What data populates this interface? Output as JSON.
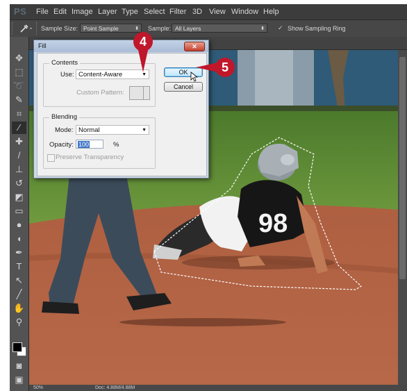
{
  "app": {
    "logo": "PS"
  },
  "menu": [
    "File",
    "Edit",
    "Image",
    "Layer",
    "Type",
    "Select",
    "Filter",
    "3D",
    "View",
    "Window",
    "Help"
  ],
  "options_bar": {
    "sample_size_label": "Sample Size:",
    "sample_size_value": "Point Sample",
    "sample_label": "Sample:",
    "sample_value": "All Layers",
    "show_ring_label": "Show Sampling Ring",
    "show_ring_checked": true
  },
  "status": {
    "zoom": "50%",
    "doc": "Doc: 4.88M/4.88M"
  },
  "fill_dialog": {
    "title": "Fill",
    "contents_group": "Contents",
    "use_label": "Use:",
    "use_value": "Content-Aware",
    "custom_pattern_label": "Custom Pattern:",
    "blending_group": "Blending",
    "mode_label": "Mode:",
    "mode_value": "Normal",
    "opacity_label": "Opacity:",
    "opacity_value": "100",
    "opacity_unit": "%",
    "preserve_label": "Preserve Transparency",
    "ok_label": "OK",
    "cancel_label": "Cancel"
  },
  "callouts": {
    "step4": "4",
    "step5": "5"
  },
  "photo": {
    "jersey_number": "98"
  },
  "colors": {
    "callout": "#c0172b",
    "dialog_frame": "#cfd9e6",
    "ps_dark": "#3a3a3a"
  }
}
